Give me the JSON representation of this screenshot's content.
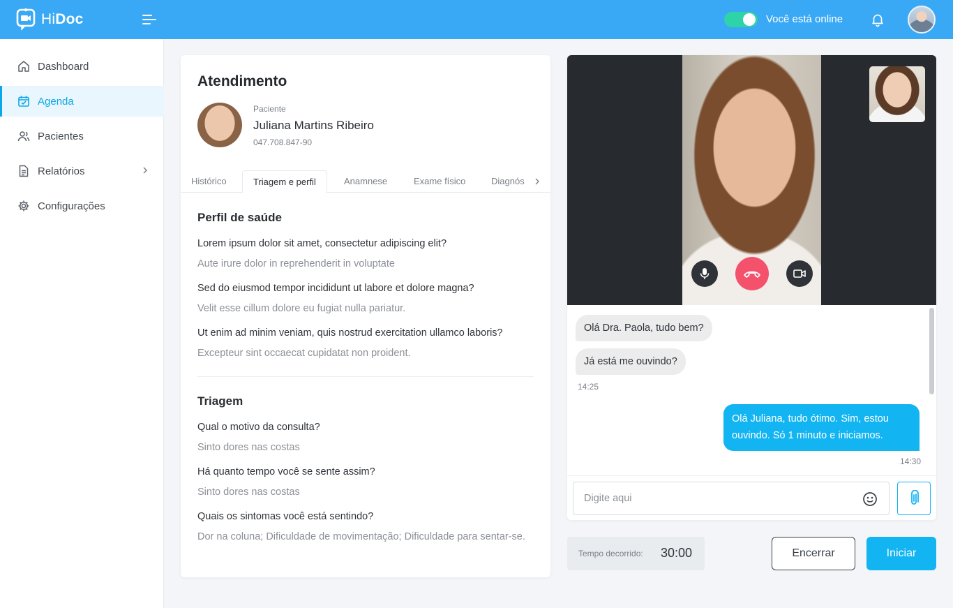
{
  "app": {
    "name_prefix": "Hi",
    "name_suffix": "Doc",
    "accent": "#3aa9f5",
    "primary": "#12b4f2"
  },
  "header": {
    "status_text": "Você está online",
    "online": true,
    "icons": [
      "menu-icon",
      "bell-icon"
    ]
  },
  "sidebar": {
    "items": [
      {
        "label": "Dashboard",
        "icon": "home-icon",
        "active": false
      },
      {
        "label": "Agenda",
        "icon": "calendar-check-icon",
        "active": true
      },
      {
        "label": "Pacientes",
        "icon": "users-icon",
        "active": false
      },
      {
        "label": "Relatórios",
        "icon": "document-icon",
        "active": false,
        "has_submenu": true
      },
      {
        "label": "Configurações",
        "icon": "gear-icon",
        "active": false
      }
    ]
  },
  "attendance": {
    "title": "Atendimento",
    "patient_label": "Paciente",
    "patient_name": "Juliana Martins Ribeiro",
    "patient_cpf": "047.708.847-90",
    "tabs": [
      {
        "label": "Histórico",
        "active": false
      },
      {
        "label": "Triagem e perfil",
        "active": true
      },
      {
        "label": "Anamnese",
        "active": false
      },
      {
        "label": "Exame físico",
        "active": false
      },
      {
        "label": "Diagnós",
        "active": false
      }
    ],
    "health_profile": {
      "title": "Perfil de saúde",
      "items": [
        {
          "q": "Lorem ipsum dolor sit amet, consectetur adipiscing elit?",
          "a": "Aute irure dolor in reprehenderit in voluptate"
        },
        {
          "q": "Sed do eiusmod tempor incididunt ut labore et dolore magna?",
          "a": "Velit esse cillum dolore eu fugiat nulla pariatur."
        },
        {
          "q": "Ut enim ad minim veniam, quis nostrud exercitation ullamco laboris?",
          "a": "Excepteur sint occaecat cupidatat non proident."
        }
      ]
    },
    "triage": {
      "title": "Triagem",
      "items": [
        {
          "q": "Qual o motivo da consulta?",
          "a": "Sinto dores nas costas"
        },
        {
          "q": "Há quanto tempo você se sente assim?",
          "a": "Sinto dores nas costas"
        },
        {
          "q": "Quais os sintomas você está sentindo?",
          "a": "Dor na coluna; Dificuldade de movimentação; Dificuldade para sentar-se."
        }
      ]
    }
  },
  "video": {
    "controls": [
      "microphone-icon",
      "hang-up-icon",
      "camera-icon"
    ]
  },
  "chat": {
    "messages": [
      {
        "from": "patient",
        "text": "Olá Dra. Paola, tudo bem?"
      },
      {
        "from": "patient",
        "text": "Já está me ouvindo?",
        "time": "14:25"
      },
      {
        "from": "doctor",
        "text": "Olá Juliana, tudo ótimo. Sim, estou ouvindo. Só 1 minuto e iniciamos.",
        "time": "14:30"
      }
    ],
    "input_placeholder": "Digite aqui",
    "input_value": ""
  },
  "session": {
    "elapsed_label": "Tempo decorrido:",
    "elapsed_value": "30:00",
    "end_label": "Encerrar",
    "start_label": "Iniciar"
  }
}
